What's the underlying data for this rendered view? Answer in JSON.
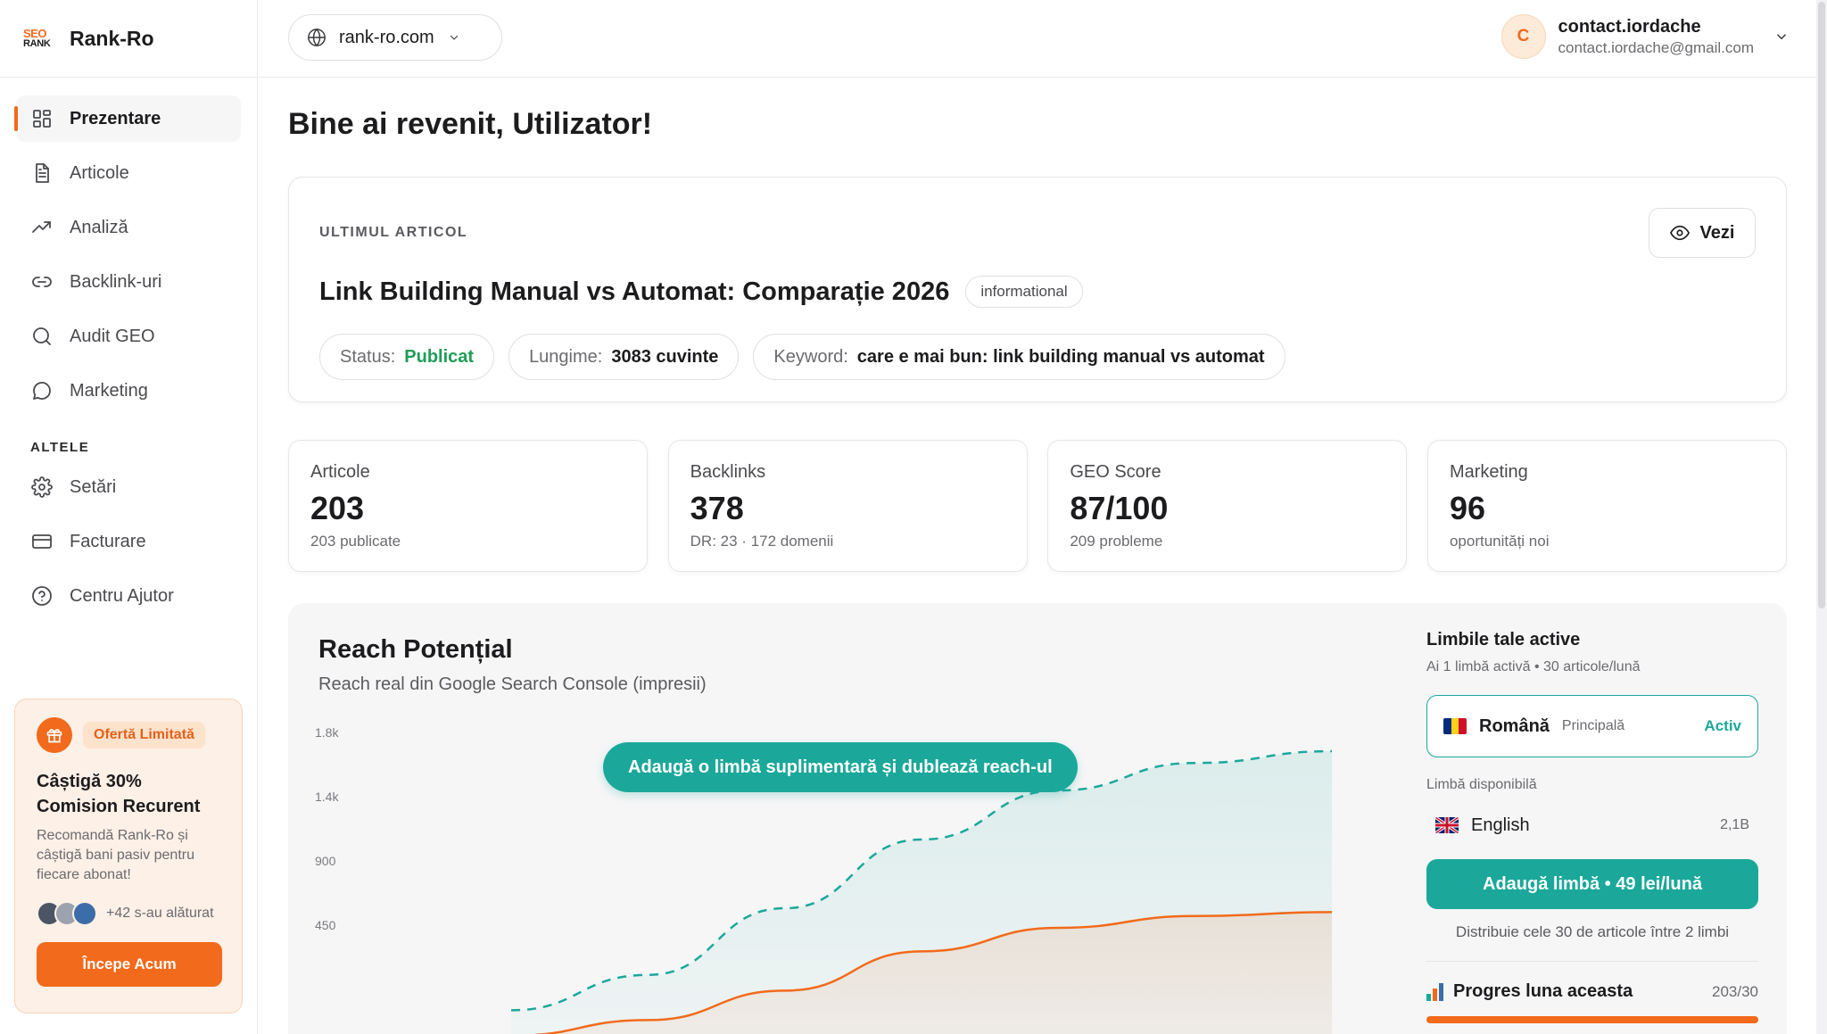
{
  "brand": {
    "logo_top": "SEO",
    "logo_bottom": "RANK",
    "name": "Rank-Ro"
  },
  "sidebar": {
    "items": [
      {
        "label": "Prezentare",
        "icon": "grid-icon",
        "active": true
      },
      {
        "label": "Articole",
        "icon": "document-icon",
        "active": false
      },
      {
        "label": "Analiză",
        "icon": "trend-icon",
        "active": false
      },
      {
        "label": "Backlink-uri",
        "icon": "link-icon",
        "active": false
      },
      {
        "label": "Audit GEO",
        "icon": "search-icon",
        "active": false
      },
      {
        "label": "Marketing",
        "icon": "chat-icon",
        "active": false
      }
    ],
    "section_label": "ALTELE",
    "other_items": [
      {
        "label": "Setări",
        "icon": "gear-icon"
      },
      {
        "label": "Facturare",
        "icon": "card-icon"
      },
      {
        "label": "Centru Ajutor",
        "icon": "help-icon"
      }
    ],
    "promo": {
      "badge": "Ofertă Limitată",
      "title": "Câștigă 30% Comision Recurent",
      "text": "Recomandă Rank-Ro și câștigă bani pasiv pentru fiecare abonat!",
      "joined": "+42 s-au alăturat",
      "button": "Începe Acum"
    }
  },
  "header": {
    "domain": "rank-ro.com",
    "user_initial": "C",
    "user_name": "contact.iordache",
    "user_email": "contact.iordache@gmail.com"
  },
  "main": {
    "greeting": "Bine ai revenit, Utilizator!",
    "last_article": {
      "label": "ULTIMUL ARTICOL",
      "view_button": "Vezi",
      "title": "Link Building Manual vs Automat: Comparație 2026",
      "tag": "informational",
      "status_label": "Status:",
      "status_value": "Publicat",
      "length_label": "Lungime:",
      "length_value": "3083 cuvinte",
      "keyword_label": "Keyword:",
      "keyword_value": "care e mai bun: link building manual vs automat"
    },
    "stats": [
      {
        "label": "Articole",
        "value": "203",
        "sub": "203 publicate"
      },
      {
        "label": "Backlinks",
        "value": "378",
        "sub": "DR: 23 · 172 domenii"
      },
      {
        "label": "GEO Score",
        "value": "87/100",
        "sub": "209 probleme"
      },
      {
        "label": "Marketing",
        "value": "96",
        "sub": "oportunități noi"
      }
    ],
    "reach": {
      "title": "Reach Potențial",
      "subtitle": "Reach real din Google Search Console (impresii)",
      "cta": "Adaugă o limbă suplimentară și dublează reach-ul"
    },
    "languages": {
      "title": "Limbile tale active",
      "subtitle": "Ai 1 limbă activă • 30 articole/lună",
      "active_name": "Română",
      "active_tag": "Principală",
      "active_status": "Activ",
      "available_label": "Limbă disponibilă",
      "available_name": "English",
      "available_count": "2,1B",
      "add_button": "Adaugă limbă • 49 lei/lună",
      "distribution": "Distribuie cele 30 de articole între 2 limbi",
      "progress_label": "Progres luna aceasta",
      "progress_count": "203/30",
      "progress_fraction": 1.0
    }
  },
  "chart_data": {
    "type": "area",
    "y_ticks": [
      "1.8k",
      "1.4k",
      "900",
      "450"
    ],
    "ylim": [
      0,
      1800
    ],
    "series": [
      {
        "style": "dashed",
        "color": "#1ba89a",
        "values": [
          380,
          560,
          900,
          1250,
          1500,
          1640,
          1700
        ]
      },
      {
        "style": "solid",
        "color": "#f26a1b",
        "values": [
          250,
          330,
          480,
          680,
          800,
          860,
          880
        ]
      }
    ]
  },
  "colors": {
    "accent": "#f26a1b",
    "teal": "#1ba89a",
    "success": "#1f9d57"
  }
}
